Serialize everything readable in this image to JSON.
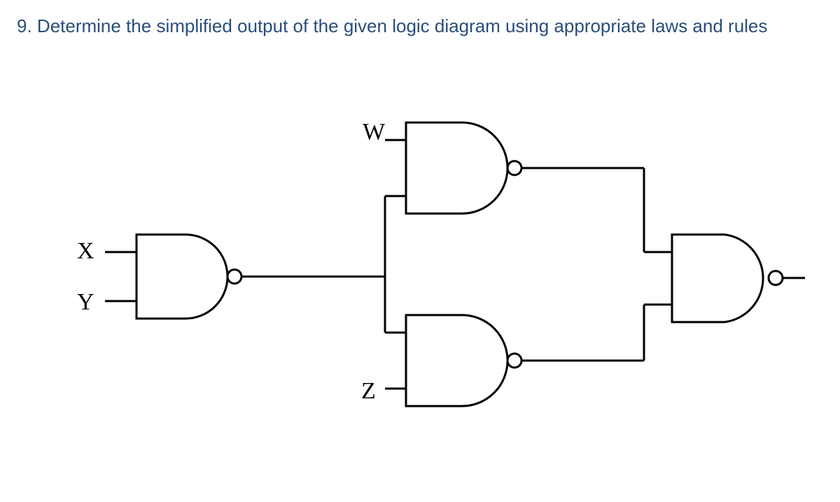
{
  "question": {
    "number": "9.",
    "text": "Determine the simplified output of the  given logic diagram  using appropriate laws and rules"
  },
  "diagram": {
    "inputs": {
      "W": "W",
      "X": "X",
      "Y": "Y",
      "Z": "Z"
    },
    "gates": [
      {
        "id": "g1",
        "type": "NAND",
        "inputs": [
          "X",
          "Y"
        ]
      },
      {
        "id": "g2",
        "type": "NAND",
        "inputs": [
          "W",
          "g1.out"
        ]
      },
      {
        "id": "g3",
        "type": "NAND",
        "inputs": [
          "g1.out",
          "Z"
        ]
      },
      {
        "id": "g4",
        "type": "NAND",
        "inputs": [
          "g2.out",
          "g3.out"
        ],
        "role": "output"
      }
    ]
  }
}
